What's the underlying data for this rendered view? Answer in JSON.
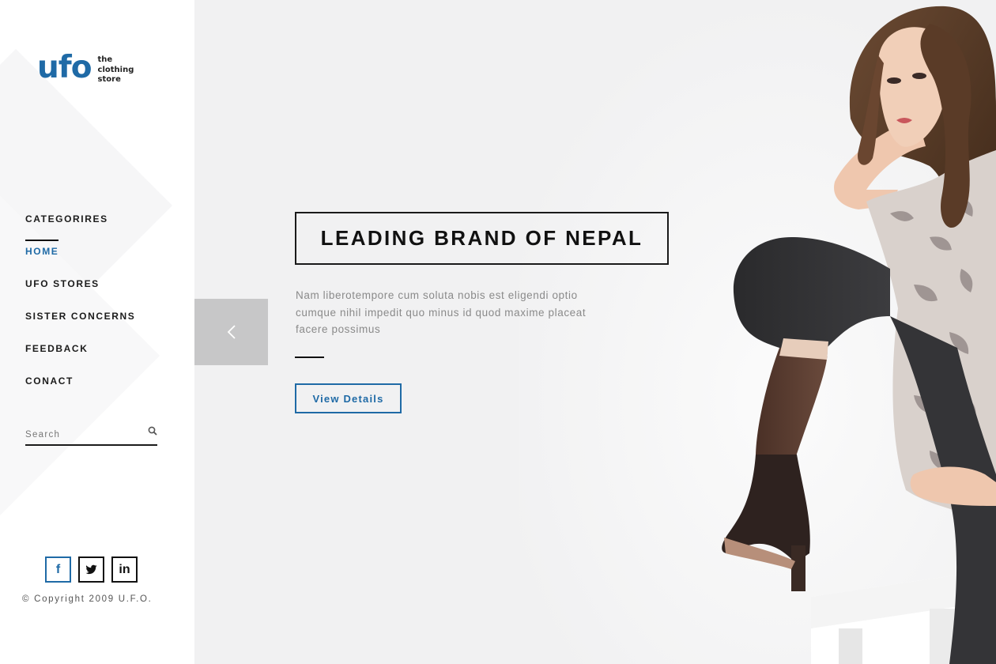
{
  "brand": {
    "logo_text": "ufo",
    "tagline": [
      "the",
      "clothing",
      "store"
    ]
  },
  "nav": {
    "heading": "CATEGORIRES",
    "items": [
      {
        "label": "HOME",
        "active": true
      },
      {
        "label": "UFO STORES",
        "active": false
      },
      {
        "label": "SISTER CONCERNS",
        "active": false
      },
      {
        "label": "FEEDBACK",
        "active": false
      },
      {
        "label": "CONACT",
        "active": false
      }
    ]
  },
  "search": {
    "placeholder": "Search",
    "icon": "search-icon"
  },
  "social": [
    {
      "label": "f",
      "icon": "facebook-icon"
    },
    {
      "label": "t",
      "icon": "twitter-icon"
    },
    {
      "label": "in",
      "icon": "linkedin-icon"
    }
  ],
  "footer": {
    "copyright": "© Copyright 2009 U.F.O."
  },
  "hero": {
    "headline": "LEADING BRAND OF NEPAL",
    "description": "Nam liberotempore cum soluta nobis est eligendi optio cumque nihil impedit quo minus id quod maxime placeat facere possimus",
    "cta_label": "View Details",
    "prev_icon": "chevron-left-icon"
  },
  "colors": {
    "accent": "#1f6aa6",
    "background": "#f1f1f2",
    "sidebar": "#ffffff",
    "text": "#111111"
  }
}
